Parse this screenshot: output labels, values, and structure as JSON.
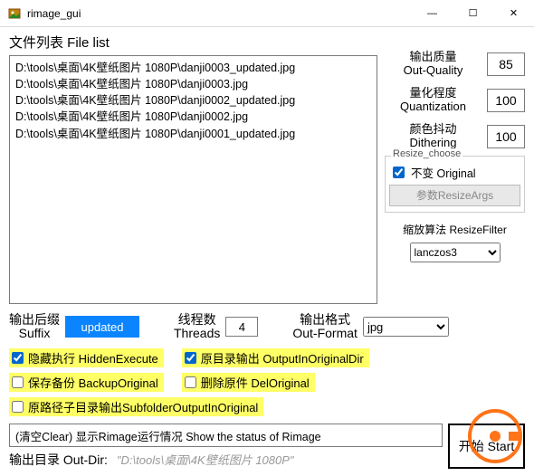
{
  "window": {
    "title": "rimage_gui",
    "min_icon": "—",
    "max_icon": "☐",
    "close_icon": "✕"
  },
  "filelist": {
    "label": "文件列表 File list",
    "items": [
      "D:\\tools\\桌面\\4K壁纸图片 1080P\\danji0003_updated.jpg",
      "D:\\tools\\桌面\\4K壁纸图片 1080P\\danji0003.jpg",
      "D:\\tools\\桌面\\4K壁纸图片 1080P\\danji0002_updated.jpg",
      "D:\\tools\\桌面\\4K壁纸图片 1080P\\danji0002.jpg",
      "D:\\tools\\桌面\\4K壁纸图片 1080P\\danji0001_updated.jpg"
    ]
  },
  "quality": {
    "label": "输出质量\nOut-Quality",
    "value": "85"
  },
  "quantization": {
    "label": "量化程度\nQuantization",
    "value": "100"
  },
  "dithering": {
    "label": "颜色抖动\nDithering",
    "value": "100"
  },
  "resize": {
    "legend": "Resize_choose",
    "original_label": "不变 Original",
    "original_checked": true,
    "args_btn": "参数ResizeArgs",
    "filter_label": "缩放算法 ResizeFilter",
    "filter_value": "lanczos3"
  },
  "suffix": {
    "label": "输出后缀\nSuffix",
    "value": "updated"
  },
  "threads": {
    "label": "线程数\nThreads",
    "value": "4"
  },
  "format": {
    "label": "输出格式\nOut-Format",
    "value": "jpg"
  },
  "checks": {
    "hidden_execute": {
      "label": "隐藏执行 HiddenExecute",
      "checked": true
    },
    "output_original_dir": {
      "label": "原目录输出 OutputInOriginalDir",
      "checked": true
    },
    "backup_original": {
      "label": "保存备份 BackupOriginal",
      "checked": false
    },
    "del_original": {
      "label": "删除原件 DelOriginal",
      "checked": false
    },
    "subfolder_output": {
      "label": "原路径子目录输出SubfolderOutputInOriginal",
      "checked": false
    }
  },
  "status": {
    "text": "(清空Clear) 显示Rimage运行情况 Show the status of Rimage"
  },
  "start_btn": "开始 Start",
  "outdir": {
    "label": "输出目录 Out-Dir:",
    "value": "\"D:\\tools\\桌面\\4K壁纸图片 1080P\""
  }
}
